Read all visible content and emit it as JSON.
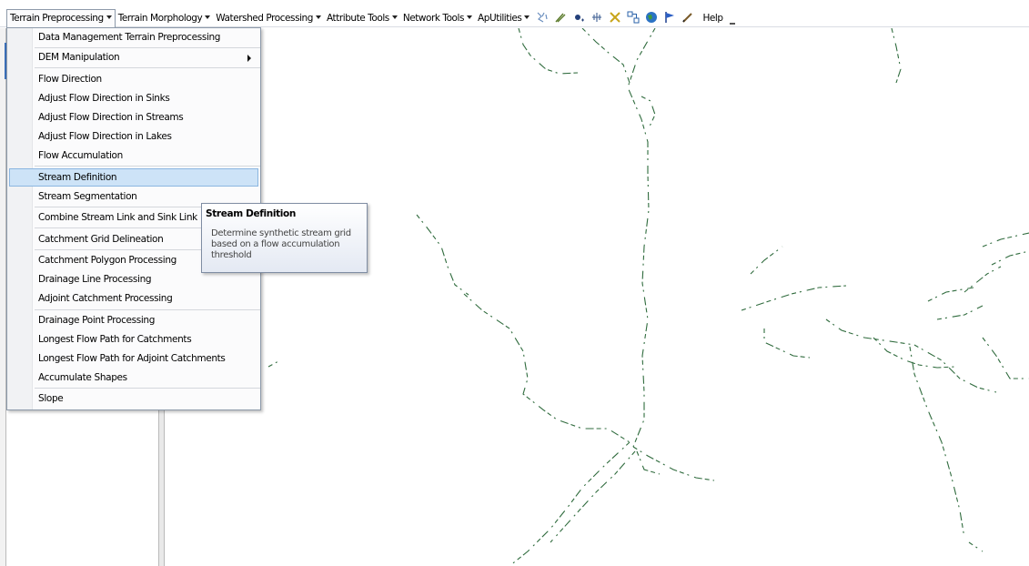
{
  "toolbar": {
    "menus": [
      {
        "label": "Terrain Preprocessing"
      },
      {
        "label": "Terrain Morphology"
      },
      {
        "label": "Watershed Processing"
      },
      {
        "label": "Attribute Tools"
      },
      {
        "label": "Network Tools"
      },
      {
        "label": "ApUtilities"
      }
    ],
    "help_label": "Help",
    "icons": [
      "flow-path-tracing-icon",
      "sketch-pen-icon",
      "point-delineation-icon",
      "batch-point-icon",
      "dam-break-icon",
      "network-icon",
      "globe-icon",
      "flag-icon",
      "pencil-icon"
    ]
  },
  "dropdown": {
    "items": [
      {
        "label": "Data Management Terrain Preprocessing"
      },
      {
        "label": "DEM Manipulation",
        "submenu": true
      },
      {
        "label": "Flow Direction"
      },
      {
        "label": "Adjust Flow Direction in Sinks"
      },
      {
        "label": "Adjust Flow Direction in Streams"
      },
      {
        "label": "Adjust Flow Direction in Lakes"
      },
      {
        "label": "Flow Accumulation"
      },
      {
        "label": "Stream Definition",
        "highlighted": true
      },
      {
        "label": "Stream Segmentation"
      },
      {
        "label": "Combine Stream Link and Sink Link"
      },
      {
        "label": "Catchment Grid Delineation"
      },
      {
        "label": "Catchment Polygon Processing"
      },
      {
        "label": "Drainage Line Processing"
      },
      {
        "label": "Adjoint Catchment Processing"
      },
      {
        "label": "Drainage Point Processing"
      },
      {
        "label": "Longest Flow Path for Catchments"
      },
      {
        "label": "Longest Flow Path for Adjoint Catchments"
      },
      {
        "label": "Accumulate Shapes"
      },
      {
        "label": "Slope"
      }
    ]
  },
  "tooltip": {
    "title": "Stream Definition",
    "body": "Determine synthetic stream grid based on a flow accumulation threshold"
  },
  "colors": {
    "stream_line": "#2f6b3d",
    "highlight_bg": "#cde3f7",
    "highlight_border": "#8bb6e0",
    "menu_border": "#8d9aaa"
  }
}
